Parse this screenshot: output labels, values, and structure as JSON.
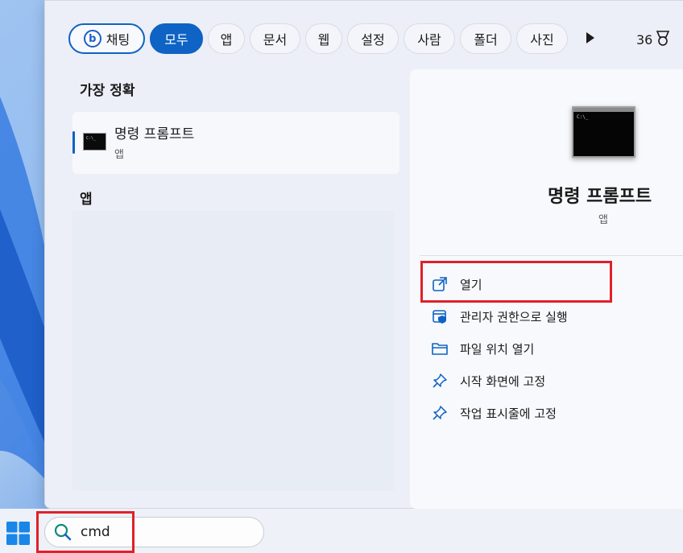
{
  "chips": [
    {
      "label": "채팅"
    },
    {
      "label": "모두"
    },
    {
      "label": "앱"
    },
    {
      "label": "문서"
    },
    {
      "label": "웹"
    },
    {
      "label": "설정"
    },
    {
      "label": "사람"
    },
    {
      "label": "폴더"
    },
    {
      "label": "사진"
    }
  ],
  "rewards_points": "36",
  "best_match": {
    "section_title": "가장 정확",
    "name": "명령 프롬프트",
    "type": "앱",
    "icon_text": "C:\\_"
  },
  "apps_section_title": "앱",
  "detail": {
    "name": "명령 프롬프트",
    "type": "앱",
    "icon_text": "C:\\_",
    "actions": [
      {
        "label": "열기",
        "icon": "open-external-icon"
      },
      {
        "label": "관리자 권한으로 실행",
        "icon": "admin-shield-icon"
      },
      {
        "label": "파일 위치 열기",
        "icon": "folder-icon"
      },
      {
        "label": "시작 화면에 고정",
        "icon": "pin-icon"
      },
      {
        "label": "작업 표시줄에 고정",
        "icon": "pin-icon"
      }
    ]
  },
  "taskbar": {
    "search_value": "cmd"
  },
  "colors": {
    "accent": "#0e63c4",
    "highlight": "#e0202a"
  }
}
